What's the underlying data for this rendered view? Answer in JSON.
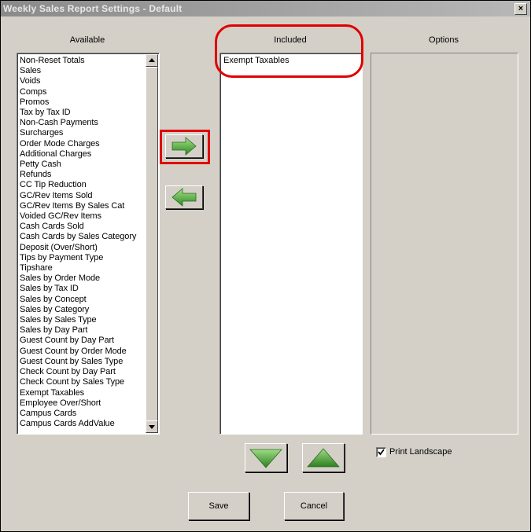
{
  "window": {
    "title": "Weekly Sales Report Settings - Default",
    "close_glyph": "×"
  },
  "columns": {
    "available": "Available",
    "included": "Included",
    "options": "Options"
  },
  "available_items": [
    "Non-Reset Totals",
    "Sales",
    "Voids",
    "Comps",
    "Promos",
    "Tax by Tax ID",
    "Non-Cash Payments",
    "Surcharges",
    "Order Mode Charges",
    "Additional Charges",
    "Petty Cash",
    "Refunds",
    "CC Tip Reduction",
    "GC/Rev Items Sold",
    "GC/Rev Items By Sales Cat",
    "Voided GC/Rev Items",
    "Cash Cards Sold",
    "Cash Cards by Sales Category",
    "Deposit (Over/Short)",
    "Tips by Payment Type",
    "Tipshare",
    "Sales by Order Mode",
    "Sales by Tax ID",
    "Sales by Concept",
    "Sales by Category",
    "Sales by Sales Type",
    "Sales by Day Part",
    "Guest Count by Day Part",
    "Guest Count by Order Mode",
    "Guest Count by Sales Type",
    "Check Count by Day Part",
    "Check Count by Sales Type",
    "Exempt Taxables",
    "Employee Over/Short",
    "Campus Cards",
    "Campus Cards AddValue"
  ],
  "included_items": [
    "Exempt Taxables"
  ],
  "options": {
    "print_landscape_label": "Print Landscape",
    "print_landscape_checked": true
  },
  "buttons": {
    "save": "Save",
    "cancel": "Cancel",
    "add_icon": "arrow-right-icon",
    "remove_icon": "arrow-left-icon",
    "move_down_icon": "triangle-down-icon",
    "move_up_icon": "triangle-up-icon"
  },
  "colors": {
    "highlight": "#e00000",
    "arrow_green": "#4aa83a"
  }
}
